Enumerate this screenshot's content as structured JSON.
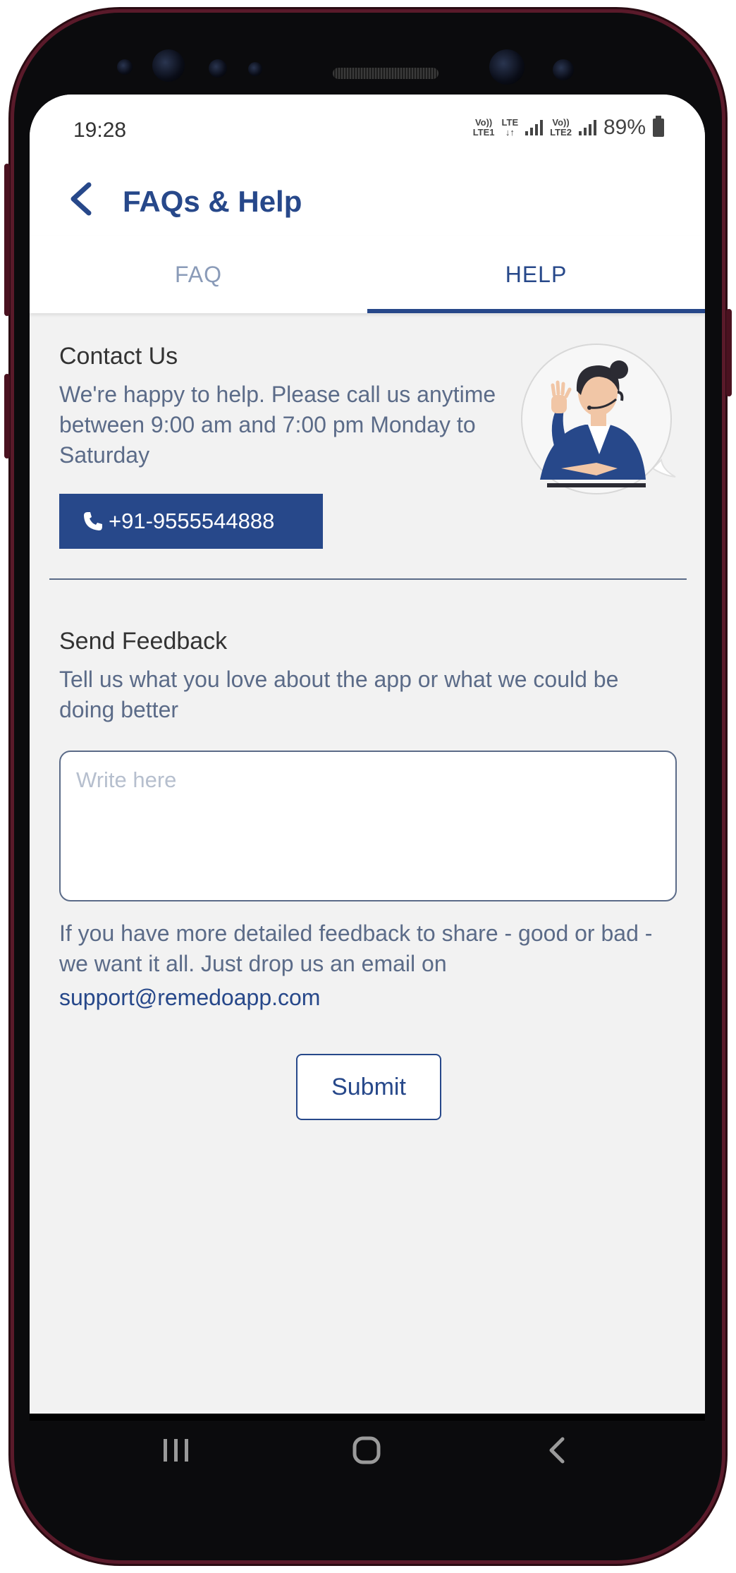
{
  "status_bar": {
    "time": "19:28",
    "network1_top": "Vo))",
    "network1_bottom": "LTE1",
    "network_mid_top": "LTE",
    "network_mid_bottom": "↓↑",
    "network2_top": "Vo))",
    "network2_bottom": "LTE2",
    "battery": "89%"
  },
  "header": {
    "title": "FAQs & Help"
  },
  "tabs": [
    {
      "label": "FAQ",
      "active": false
    },
    {
      "label": "HELP",
      "active": true
    }
  ],
  "contact": {
    "title": "Contact Us",
    "text": "We're happy to help. Please call us anytime between 9:00 am and 7:00 pm Monday to Saturday",
    "phone_number": "+91-9555544888"
  },
  "feedback": {
    "title": "Send Feedback",
    "text": "Tell us what you love about the app or what we could be doing better",
    "input_placeholder": "Write here",
    "input_value": "",
    "more_text": "If you have more detailed feedback to share - good or bad - we want it all. Just drop us an email on",
    "email": "support@remedoapp.com",
    "submit_label": "Submit"
  },
  "colors": {
    "accent": "#27488a",
    "muted_text": "#5b6b88",
    "background": "#f2f2f2",
    "tab_inactive": "#8a9bb8"
  },
  "icons": {
    "back": "chevron-left-icon",
    "phone": "phone-icon",
    "nav_recent": "recent-apps-icon",
    "nav_home": "home-icon",
    "nav_back": "back-icon"
  }
}
